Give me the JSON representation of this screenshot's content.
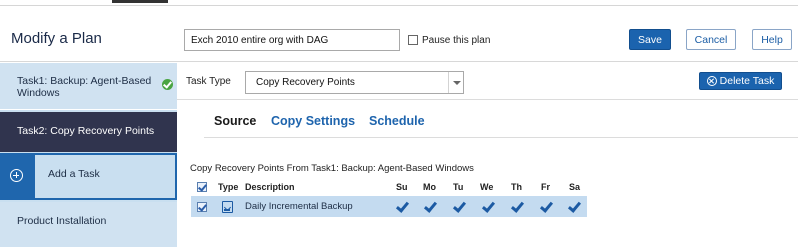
{
  "header": {
    "title": "Modify a Plan",
    "plan_name": "Exch 2010 entire org with DAG",
    "pause_label": "Pause this plan",
    "pause_checked": false,
    "save_label": "Save",
    "cancel_label": "Cancel",
    "help_label": "Help"
  },
  "sidebar": {
    "items": [
      {
        "label": "Task1: Backup: Agent-Based Windows",
        "status_icon": "check-circle-icon",
        "state": "completed"
      },
      {
        "label": "Task2: Copy Recovery Points",
        "state": "selected"
      },
      {
        "label": "Add a Task",
        "icon": "add-circle-icon"
      },
      {
        "label": "Product Installation"
      }
    ]
  },
  "task": {
    "type_label": "Task Type",
    "type_value": "Copy Recovery Points",
    "delete_label": "Delete Task"
  },
  "tabs": [
    {
      "label": "Source",
      "active": true
    },
    {
      "label": "Copy Settings",
      "active": false
    },
    {
      "label": "Schedule",
      "active": false
    }
  ],
  "grid": {
    "title": "Copy Recovery Points From Task1: Backup: Agent-Based Windows",
    "columns": [
      "Type",
      "Description",
      "Su",
      "Mo",
      "Tu",
      "We",
      "Th",
      "Fr",
      "Sa"
    ],
    "rows": [
      {
        "checked": true,
        "type_icon": "backup-type-icon",
        "description": "Daily Incremental Backup",
        "days": [
          true,
          true,
          true,
          true,
          true,
          true,
          true
        ]
      }
    ]
  },
  "colors": {
    "accent": "#1b63ae",
    "sidebar_bg": "#c9dff0",
    "sidebar_selected": "#30344e",
    "row_highlight": "#c4dbf0",
    "success": "#4aa442"
  }
}
